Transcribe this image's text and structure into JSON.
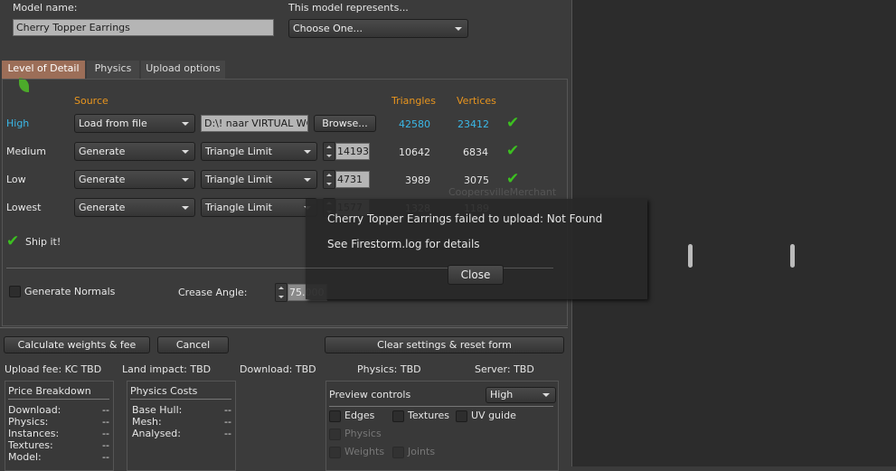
{
  "model_name": {
    "label": "Model name:",
    "value": "Cherry Topper Earrings"
  },
  "represents": {
    "label": "This model represents...",
    "value": "Choose One..."
  },
  "tabs": [
    "Level of Detail",
    "Physics",
    "Upload options"
  ],
  "headers": {
    "source": "Source",
    "triangles": "Triangles",
    "vertices": "Vertices"
  },
  "lod": [
    {
      "name": "High",
      "source": "Load from file",
      "file": "D:\\! naar VIRTUAL WO",
      "browse": "Browse...",
      "triangles": "42580",
      "vertices": "23412"
    },
    {
      "name": "Medium",
      "source": "Generate",
      "mode": "Triangle Limit",
      "limit": "14193",
      "triangles": "10642",
      "vertices": "6834"
    },
    {
      "name": "Low",
      "source": "Generate",
      "mode": "Triangle Limit",
      "limit": "4731",
      "triangles": "3989",
      "vertices": "3075"
    },
    {
      "name": "Lowest",
      "source": "Generate",
      "mode": "Triangle Limit",
      "limit": "1577",
      "triangles": "1328",
      "vertices": "1189"
    }
  ],
  "ship_it": "Ship it!",
  "generate_normals": "Generate Normals",
  "crease_angle": {
    "label": "Crease Angle:",
    "value": "75.000"
  },
  "buttons": {
    "calc": "Calculate weights & fee",
    "cancel": "Cancel",
    "clear": "Clear settings & reset form"
  },
  "stats": {
    "upload_fee": "Upload fee: KC TBD",
    "land_impact": "Land impact: TBD",
    "download": "Download: TBD",
    "physics": "Physics: TBD",
    "server": "Server: TBD"
  },
  "price": {
    "title": "Price Breakdown",
    "rows": [
      [
        "Download:",
        "--"
      ],
      [
        "Physics:",
        "--"
      ],
      [
        "Instances:",
        "--"
      ],
      [
        "Textures:",
        "--"
      ],
      [
        "Model:",
        "--"
      ]
    ]
  },
  "physics_costs": {
    "title": "Physics Costs",
    "rows": [
      [
        "Base Hull:",
        "--"
      ],
      [
        "Mesh:",
        "--"
      ],
      [
        "Analysed:",
        "--"
      ]
    ]
  },
  "preview": {
    "title": "Preview controls",
    "lod": "High",
    "edges": "Edges",
    "textures": "Textures",
    "uv": "UV guide",
    "physics": "Physics",
    "weights": "Weights",
    "joints": "Joints"
  },
  "watermark": "CoopersvilleMerchant",
  "toast": {
    "message": "Cherry Topper Earrings failed to upload: Not Found",
    "detail": "See Firestorm.log for details",
    "close": "Close"
  }
}
